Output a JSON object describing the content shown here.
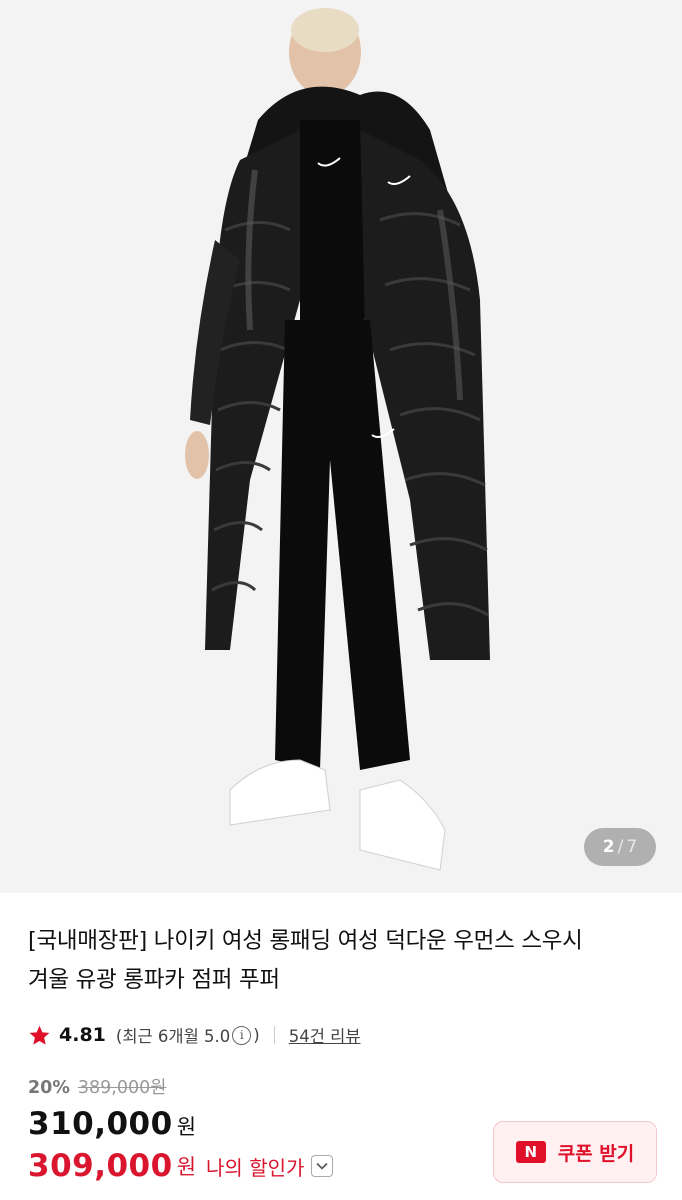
{
  "gallery": {
    "image_alt": "",
    "current": "2",
    "separator": "/",
    "total": "7"
  },
  "product": {
    "title_line1": "[국내매장판] 나이키 여성 롱패딩 여성 덕다운 우먼스 스우시",
    "title_line2": "겨울 유광 롱파카 점퍼 푸퍼"
  },
  "rating": {
    "score": "4.81",
    "recent_prefix": "(최근 6개월 5.0",
    "recent_suffix": ")",
    "info_glyph": "i",
    "review_link": "54건 리뷰"
  },
  "pricing": {
    "discount_rate": "20%",
    "original_price": "389,000원",
    "price": "310,000",
    "currency": "원",
    "my_price": "309,000",
    "my_currency": "원",
    "my_price_label": "나의 할인가"
  },
  "coupon": {
    "badge": "N",
    "label": "쿠폰 받기"
  },
  "colors": {
    "accent_red": "#d9162d",
    "coupon_bg": "#fff1f2",
    "image_bg": "#f3f3f3"
  },
  "icons": {
    "star": "star-icon",
    "info": "info-icon",
    "chevron": "chevron-down-icon"
  }
}
